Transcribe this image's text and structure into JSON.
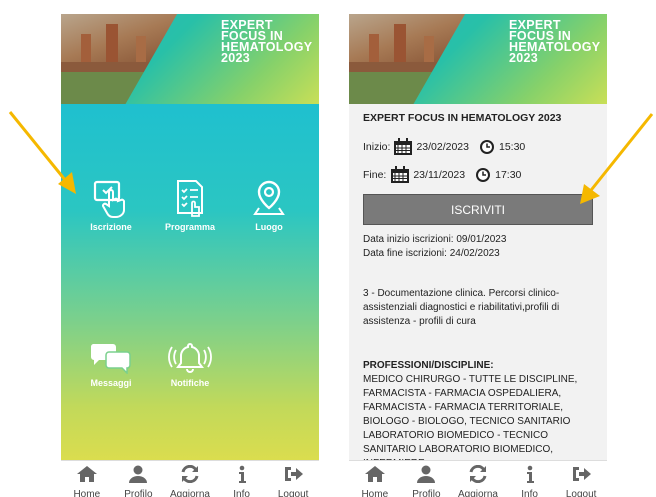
{
  "banner": {
    "title": "EXPERT FOCUS IN\nHEMATOLOGY\n2023"
  },
  "menu": {
    "items": [
      {
        "label": "Iscrizione",
        "icon": "hand-tap-icon"
      },
      {
        "label": "Programma",
        "icon": "checklist-icon"
      },
      {
        "label": "Luogo",
        "icon": "location-pin-icon"
      },
      {
        "label": "Messaggi",
        "icon": "chat-bubbles-icon"
      },
      {
        "label": "Notifiche",
        "icon": "bell-icon"
      }
    ]
  },
  "event": {
    "title": "EXPERT FOCUS IN HEMATOLOGY 2023",
    "start_label": "Inizio:",
    "start_date": "23/02/2023",
    "start_time": "15:30",
    "end_label": "Fine:",
    "end_date": "23/11/2023",
    "end_time": "17:30",
    "button": "ISCRIVITI",
    "reg_start": "Data inizio iscrizioni: 09/01/2023",
    "reg_end": "Data fine iscrizioni: 24/02/2023",
    "description": "3 - Documentazione clinica. Percorsi clinico-assistenziali diagnostici e riabilitativi,profili di assistenza - profili di cura",
    "prof_heading": "PROFESSIONI/DISCIPLINE:",
    "prof_text": "MEDICO CHIRURGO - TUTTE LE DISCIPLINE, FARMACISTA - FARMACIA OSPEDALIERA, FARMACISTA - FARMACIA TERRITORIALE, BIOLOGO - BIOLOGO, TECNICO SANITARIO LABORATORIO BIOMEDICO - TECNICO SANITARIO LABORATORIO BIOMEDICO, INFERMIERE"
  },
  "nav": [
    {
      "label": "Home",
      "icon": "home-icon"
    },
    {
      "label": "Profilo",
      "icon": "user-icon"
    },
    {
      "label": "Aggiorna",
      "icon": "refresh-icon"
    },
    {
      "label": "Info",
      "icon": "info-icon"
    },
    {
      "label": "Logout",
      "icon": "logout-icon"
    }
  ],
  "colors": {
    "arrow": "#f5b800",
    "gradient_top": "#1fc0cf",
    "gradient_bottom": "#dbdd4e",
    "button": "#7a7a7a"
  }
}
